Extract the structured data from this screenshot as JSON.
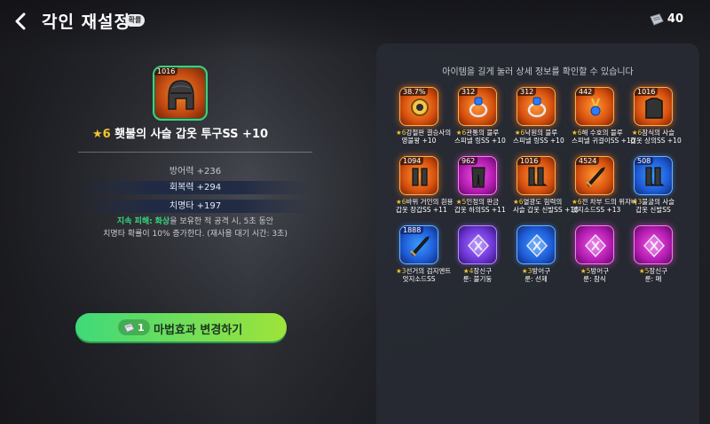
{
  "header": {
    "title": "각인 재설정",
    "badge": "확률",
    "currency_amount": "40"
  },
  "selected_item": {
    "level": "1016",
    "star_count": "6",
    "name": "횃불의 사슬 갑옷 투구SS +10",
    "icon": "helmet-icon"
  },
  "stats": {
    "defense": "방어력 +236",
    "recovery": "회복력 +294",
    "crit": "치명타 +197"
  },
  "effect": {
    "label": "지속 피해:",
    "keyword": "화상",
    "line1_rest": "을 보유한 적 공격 시, 5초 동안",
    "line2": "치명타 확률이 10% 증가한다. (재사용 대기 시간: 3초)"
  },
  "change_button": {
    "cost": "1",
    "label": "마법효과 변경하기"
  },
  "panel": {
    "hint": "아이템을 길게 눌러 상세 정보를 확인할 수 있습니다"
  },
  "inventory": [
    {
      "tag": "38.7%",
      "star": "★6",
      "line1": "강철판 결승사의",
      "line2": "영불왕 +10",
      "color": "orange",
      "icon": "amulet-icon"
    },
    {
      "tag": "312",
      "star": "★6",
      "line1": "관통의 블루",
      "line2": "스피넬 링SS +10",
      "color": "orange",
      "icon": "ring-icon"
    },
    {
      "tag": "312",
      "star": "★6",
      "line1": "낙원의 블루",
      "line2": "스피넬 링SS +10",
      "color": "orange",
      "icon": "ring-icon"
    },
    {
      "tag": "442",
      "star": "★6",
      "line1": "해 수호의 블루",
      "line2": "스피넬 귀걸이SS +10",
      "color": "orange",
      "icon": "earring-icon"
    },
    {
      "tag": "1016",
      "star": "★6",
      "line1": "잠식의 사슬",
      "line2": "갑옷 상의SS +10",
      "color": "orange",
      "icon": "armor-top-icon"
    },
    {
      "tag": "1094",
      "star": "★6",
      "line1": "바위 거인의 흰용",
      "line2": "갑옷 장갑SS +11",
      "color": "orange",
      "icon": "gloves-icon"
    },
    {
      "tag": "962",
      "star": "★5",
      "line1": "인정의 판금",
      "line2": "갑옷 하의SS +11",
      "color": "pink",
      "icon": "armor-pants-icon"
    },
    {
      "tag": "1016",
      "star": "★6",
      "line1": "열광도 힘력의",
      "line2": "사슬 갑옷 신발SS +10",
      "color": "orange",
      "icon": "boots-icon"
    },
    {
      "tag": "4524",
      "star": "★6",
      "line1": "전 차부 드의 위자버",
      "line2": "엇지소드SS +13",
      "color": "orange",
      "icon": "sword-icon"
    },
    {
      "tag": "508",
      "star": "★3",
      "line1": "불굴의 사슬",
      "line2": "갑옷 신발SS",
      "color": "blue",
      "icon": "boots-icon"
    },
    {
      "tag": "1888",
      "star": "★3",
      "line1": "선거의 검지엔트",
      "line2": "엇지소드SS",
      "color": "blue",
      "icon": "sword-icon"
    },
    {
      "tag": "",
      "star": "★4",
      "line1": "장신구",
      "line2": "룬: 불기둥",
      "color": "purple",
      "icon": "rune-icon"
    },
    {
      "tag": "",
      "star": "★3",
      "line1": "방어구",
      "line2": "룬: 선제",
      "color": "blue",
      "icon": "rune-icon"
    },
    {
      "tag": "",
      "star": "★5",
      "line1": "방어구",
      "line2": "룬: 잠식",
      "color": "pink",
      "icon": "rune-icon"
    },
    {
      "tag": "",
      "star": "★5",
      "line1": "장신구",
      "line2": "룬: 매",
      "color": "pink",
      "icon": "rune-icon"
    }
  ]
}
